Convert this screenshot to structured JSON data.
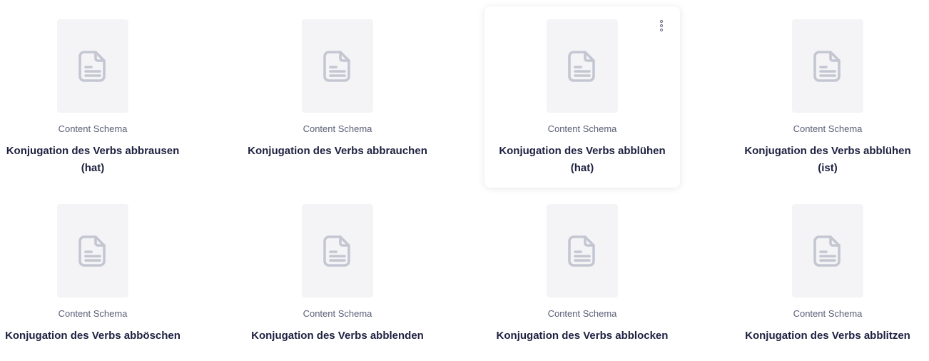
{
  "icons": {
    "thumbnail": "document-icon",
    "menu": "more-vertical-icon"
  },
  "colors": {
    "thumbnail_bg": "#f4f4f7",
    "icon": "#c4c6d2",
    "title": "#1e2140",
    "type": "#5b5f77"
  },
  "items": [
    {
      "type": "Content Schema",
      "title": "Konjugation des Verbs abbrausen (hat)"
    },
    {
      "type": "Content Schema",
      "title": "Konjugation des Verbs abbrauchen"
    },
    {
      "type": "Content Schema",
      "title": "Konjugation des Verbs abblühen (hat)"
    },
    {
      "type": "Content Schema",
      "title": "Konjugation des Verbs abblühen (ist)"
    },
    {
      "type": "Content Schema",
      "title": "Konjugation des Verbs abböschen"
    },
    {
      "type": "Content Schema",
      "title": "Konjugation des Verbs abblenden"
    },
    {
      "type": "Content Schema",
      "title": "Konjugation des Verbs abblocken"
    },
    {
      "type": "Content Schema",
      "title": "Konjugation des Verbs abblitzen"
    }
  ]
}
